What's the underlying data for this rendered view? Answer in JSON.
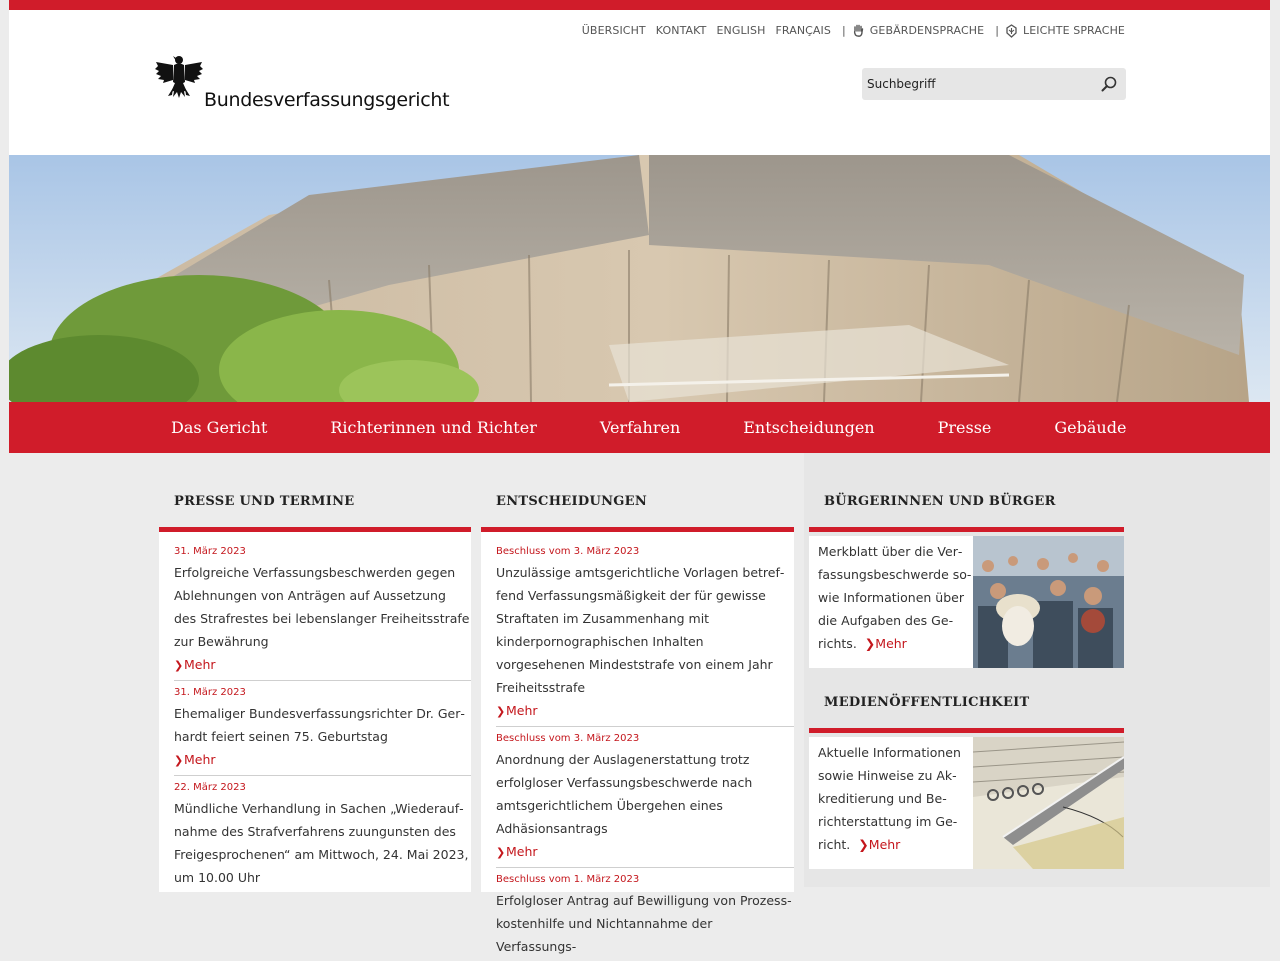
{
  "service_nav": {
    "items": [
      "ÜBERSICHT",
      "KONTAKT",
      "ENGLISH",
      "FRANÇAIS"
    ],
    "sign_language": "GEBÄRDENSPRACHE",
    "easy_language": "LEICHTE SPRACHE",
    "separator": "|"
  },
  "logo": {
    "text": "Bundesverfassungsgericht"
  },
  "search": {
    "placeholder": "Suchbegriff"
  },
  "main_nav": [
    "Das Gericht",
    "Richterinnen und Richter",
    "Verfahren",
    "Entscheidungen",
    "Presse",
    "Gebäude"
  ],
  "press": {
    "title": "PRESSE UND TERMINE",
    "items": [
      {
        "date": "31. März 2023",
        "text": "Erfolgreiche Verfassungsbeschwerden gegen Ab­lehnungen von Anträgen auf Aussetzung des Strafrestes bei lebenslanger Freiheitsstrafe zur Bewährung",
        "more": "Mehr"
      },
      {
        "date": "31. März 2023",
        "text": "Ehemaliger Bundesverfassungsrichter Dr. Ger­hardt feiert seinen 75. Geburtstag",
        "more": "Mehr"
      },
      {
        "date": "22. März 2023",
        "text": "Mündliche Verhandlung in Sachen „Wiederauf­nahme des Strafverfahrens zuungunsten des Freigesprochenen“ am Mittwoch, 24. Mai 2023, um 10.00 Uhr",
        "more": ""
      }
    ]
  },
  "decisions": {
    "title": "ENTSCHEIDUNGEN",
    "items": [
      {
        "date": "Beschluss vom 3. März 2023",
        "text": "Unzulässige amtsgerichtliche Vorlagen betref­fend Verfassungsmäßigkeit der für gewisse Straf­taten im Zusammenhang mit kinderpornogra­phischen Inhalten vorgesehenen Mindeststrafe von einem Jahr Freiheitsstrafe",
        "more": "Mehr"
      },
      {
        "date": "Beschluss vom 3. März 2023",
        "text": "Anordnung der Auslagenerstattung trotz erfolg­loser Verfassungsbeschwerde nach amtsgericht­lichem Übergehen eines Adhäsionsantrags",
        "more": "Mehr"
      },
      {
        "date": "Beschluss vom 1. März 2023",
        "text": "Erfolgloser Antrag auf Bewilligung von Prozess­kostenhilfe und Nichtannahme der Verfassungs-",
        "more": ""
      }
    ]
  },
  "citizens": {
    "title": "BÜRGERINNEN UND BÜRGER",
    "text": "Merkblatt über die Ver­fassungsbeschwerde so­wie Informationen über die Aufgaben des Ge­richts.",
    "more": "Mehr"
  },
  "media": {
    "title": "MEDIENÖFFENTLICHKEIT",
    "text": "Aktuelle Informationen sowie Hinweise zu Ak­kreditierung und Be­richterstattung im Ge­richt.",
    "more": "Mehr"
  },
  "colors": {
    "brand_red": "#d01c2a",
    "link_red": "#c4161c"
  }
}
